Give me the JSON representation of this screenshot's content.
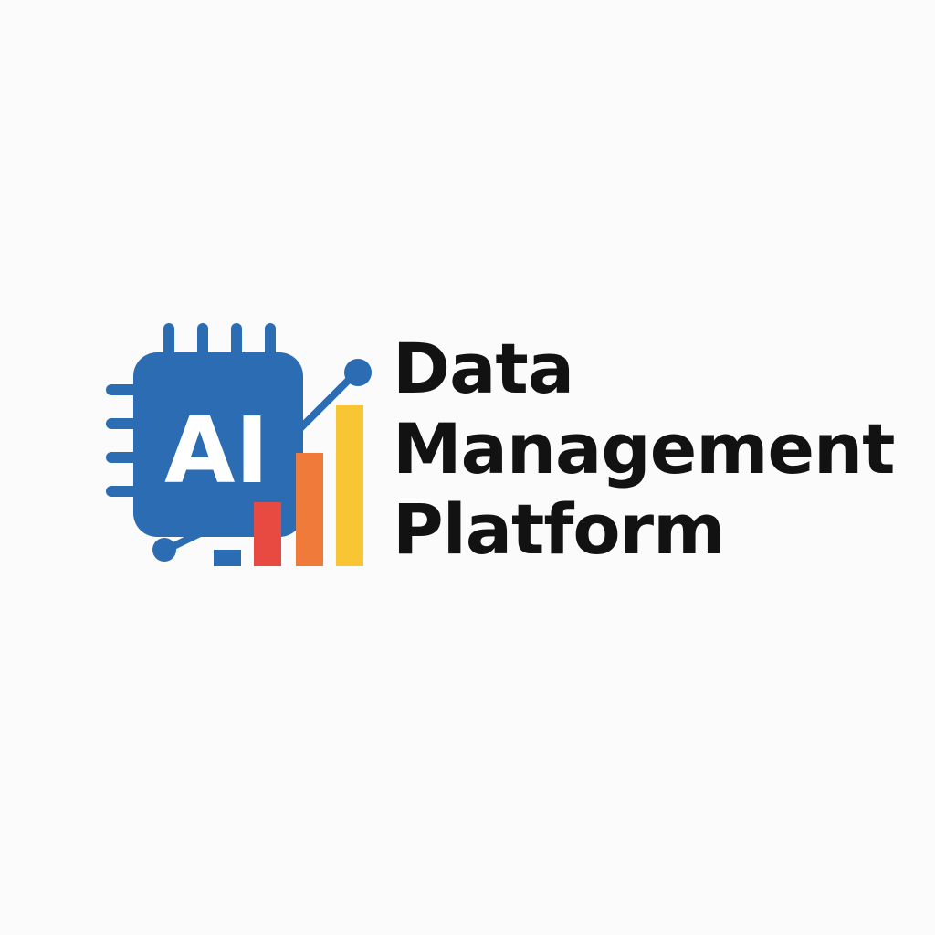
{
  "logo": {
    "chip_text": "AI",
    "colors": {
      "chip_blue": "#2b6cb3",
      "bar_red": "#e84a42",
      "bar_orange": "#f07a3a",
      "bar_yellow": "#f8c634",
      "text_dark": "#121212",
      "background": "#fbfbfb"
    },
    "icon": "ai-chip-with-growth-bars-icon"
  },
  "wordmark": {
    "line1": "Data",
    "line2": "Management",
    "line3": "Platform"
  }
}
